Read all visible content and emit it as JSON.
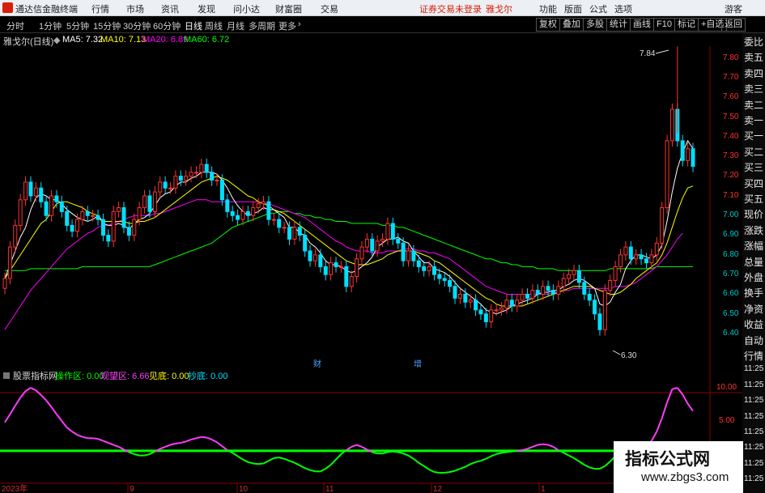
{
  "titlebar": {
    "app_name": "通达信金融终端",
    "menu": [
      "行情",
      "市场",
      "资讯",
      "发现",
      "问小达",
      "财富圈",
      "交易"
    ],
    "login_notice": "证券交易未登录",
    "stock_short": "雅戈尔",
    "right_menu": [
      "功能",
      "版面",
      "公式",
      "选项"
    ],
    "guest": "游客"
  },
  "toolbar": {
    "periods": [
      "分时",
      "1分钟",
      "5分钟",
      "15分钟",
      "30分钟",
      "60分钟",
      "日线",
      "周线",
      "月线",
      "多周期",
      "更多"
    ],
    "active_period": "日线",
    "buttons": [
      "复权",
      "叠加",
      "多股",
      "统计",
      "画线",
      "F10",
      "标记",
      "+自选",
      "返回"
    ]
  },
  "chart_header": {
    "name": "雅戈尔(日线)",
    "ma5": "MA5: 7.32",
    "ma10": "MA10: 7.13",
    "ma20": "MA20: 6.89",
    "ma60": "MA60: 6.72"
  },
  "indicator_header": {
    "name": "股票指标网",
    "op": "操作区: 0.00",
    "watch": "观望区: 6.66",
    "bottom": "见底: 0.00",
    "buy": "抄底: 0.00"
  },
  "price_axis": [
    "7.80",
    "7.70",
    "7.60",
    "7.50",
    "7.40",
    "7.30",
    "7.20",
    "7.10",
    "7.00",
    "6.90",
    "6.80",
    "6.70",
    "6.60",
    "6.50",
    "6.40"
  ],
  "ind_axis": [
    "10.00",
    "5.00"
  ],
  "annotations": {
    "high": "7.84",
    "low": "6.30"
  },
  "date_labels": [
    "2023年",
    "9",
    "10",
    "11",
    "12",
    "1"
  ],
  "event_markers": [
    "财",
    "增"
  ],
  "side_panel": [
    "委比",
    "卖五",
    "卖四",
    "卖三",
    "卖二",
    "卖一",
    "买一",
    "买二",
    "买三",
    "买四",
    "买五",
    "现价",
    "涨跌",
    "涨幅",
    "总量",
    "外盘",
    "换手",
    "净资",
    "收益",
    "自动",
    "行情",
    "11:25",
    "11:25",
    "11:25",
    "11:25",
    "11:25",
    "11:25",
    "11:25",
    "11:25"
  ],
  "watermark": {
    "title": "指标公式网",
    "url": "www.zbgs3.com"
  },
  "colors": {
    "up": "#ff3232",
    "down": "#00e0ff",
    "ma5": "#ffffff",
    "ma10": "#ffff00",
    "ma20": "#ff00ff",
    "ma60": "#00ff00",
    "ind_line": "#ff3cff",
    "ind_baseline": "#00ff00"
  },
  "chart_data": {
    "type": "candlestick",
    "title": "雅戈尔(日线)",
    "closes": [
      6.66,
      6.82,
      6.93,
      7.06,
      7.15,
      7.08,
      7.12,
      7.05,
      6.98,
      7.08,
      7.05,
      7.0,
      6.93,
      6.9,
      6.96,
      7.0,
      6.98,
      6.98,
      6.96,
      6.88,
      6.85,
      7.0,
      7.02,
      6.92,
      6.88,
      6.96,
      7.02,
      7.08,
      7.0,
      7.1,
      7.15,
      7.12,
      7.12,
      7.18,
      7.16,
      7.18,
      7.2,
      7.2,
      7.24,
      7.2,
      7.16,
      7.16,
      7.06,
      7.0,
      6.98,
      6.96,
      7.0,
      6.98,
      7.02,
      7.04,
      7.05,
      6.96,
      6.96,
      6.92,
      6.92,
      6.86,
      6.92,
      6.88,
      6.8,
      6.75,
      6.78,
      6.72,
      6.68,
      6.74,
      6.72,
      6.72,
      6.62,
      6.67,
      6.76,
      6.82,
      6.86,
      6.8,
      6.85,
      6.86,
      6.94,
      6.86,
      6.84,
      6.75,
      6.8,
      6.75,
      6.72,
      6.7,
      6.72,
      6.68,
      6.66,
      6.65,
      6.62,
      6.56,
      6.58,
      6.54,
      6.55,
      6.5,
      6.48,
      6.44,
      6.5,
      6.5,
      6.51,
      6.55,
      6.52,
      6.55,
      6.58,
      6.56,
      6.6,
      6.58,
      6.62,
      6.6,
      6.58,
      6.62,
      6.66,
      6.68,
      6.7,
      6.64,
      6.58,
      6.55,
      6.48,
      6.4,
      6.6,
      6.65,
      6.72,
      6.78,
      6.82,
      6.76,
      6.78,
      6.76,
      6.74,
      6.78,
      6.84,
      7.02,
      7.36,
      7.52,
      7.36,
      7.26,
      7.32,
      7.23
    ],
    "ma5": [
      6.66,
      6.73,
      6.8,
      6.87,
      6.92,
      7.01,
      7.07,
      7.09,
      7.08,
      7.06,
      7.06,
      7.04,
      7.01,
      6.99,
      6.97,
      6.96,
      6.95,
      6.96,
      6.98,
      6.94,
      6.93,
      6.93,
      6.94,
      6.93,
      6.91,
      6.94,
      6.96,
      6.97,
      6.99,
      7.03,
      7.07,
      7.09,
      7.1,
      7.13,
      7.15,
      7.15,
      7.17,
      7.18,
      7.2,
      7.2,
      7.2,
      7.19,
      7.16,
      7.12,
      7.07,
      7.03,
      7.0,
      6.98,
      6.99,
      7.0,
      7.02,
      7.01,
      7.01,
      6.99,
      6.97,
      6.92,
      6.92,
      6.89,
      6.88,
      6.84,
      6.82,
      6.79,
      6.75,
      6.73,
      6.73,
      6.72,
      6.7,
      6.69,
      6.7,
      6.72,
      6.74,
      6.77,
      6.82,
      6.84,
      6.86,
      6.86,
      6.87,
      6.85,
      6.84,
      6.8,
      6.77,
      6.74,
      6.74,
      6.71,
      6.7,
      6.69,
      6.67,
      6.64,
      6.61,
      6.59,
      6.57,
      6.55,
      6.53,
      6.5,
      6.49,
      6.48,
      6.49,
      6.5,
      6.52,
      6.53,
      6.54,
      6.55,
      6.56,
      6.58,
      6.59,
      6.59,
      6.6,
      6.6,
      6.62,
      6.63,
      6.65,
      6.66,
      6.65,
      6.63,
      6.61,
      6.53,
      6.52,
      6.54,
      6.59,
      6.63,
      6.71,
      6.75,
      6.78,
      6.78,
      6.77,
      6.76,
      6.78,
      6.83,
      6.95,
      7.1,
      7.22,
      7.3,
      7.36,
      7.32
    ],
    "ma10": [
      6.66,
      6.7,
      6.74,
      6.78,
      6.82,
      6.86,
      6.9,
      6.94,
      6.96,
      7.0,
      7.04,
      7.05,
      7.05,
      7.04,
      7.03,
      7.02,
      7.0,
      6.99,
      6.98,
      6.95,
      6.95,
      6.95,
      6.95,
      6.95,
      6.94,
      6.94,
      6.95,
      6.95,
      6.96,
      6.97,
      6.99,
      7.01,
      7.03,
      7.05,
      7.07,
      7.09,
      7.11,
      7.13,
      7.15,
      7.16,
      7.17,
      7.18,
      7.17,
      7.16,
      7.14,
      7.12,
      7.1,
      7.08,
      7.07,
      7.05,
      7.04,
      7.03,
      7.01,
      7.0,
      6.99,
      6.97,
      6.95,
      6.93,
      6.91,
      6.89,
      6.87,
      6.85,
      6.83,
      6.81,
      6.79,
      6.77,
      6.75,
      6.74,
      6.73,
      6.73,
      6.73,
      6.74,
      6.75,
      6.76,
      6.78,
      6.79,
      6.8,
      6.8,
      6.8,
      6.8,
      6.79,
      6.78,
      6.77,
      6.75,
      6.74,
      6.72,
      6.7,
      6.68,
      6.66,
      6.64,
      6.62,
      6.6,
      6.58,
      6.56,
      6.55,
      6.53,
      6.52,
      6.52,
      6.52,
      6.52,
      6.52,
      6.53,
      6.54,
      6.55,
      6.56,
      6.57,
      6.58,
      6.59,
      6.6,
      6.61,
      6.62,
      6.62,
      6.62,
      6.62,
      6.61,
      6.6,
      6.59,
      6.58,
      6.58,
      6.59,
      6.61,
      6.63,
      6.66,
      6.68,
      6.7,
      6.72,
      6.74,
      6.78,
      6.84,
      6.92,
      7.0,
      7.07,
      7.12,
      7.13
    ],
    "ma20": [
      6.4,
      6.44,
      6.48,
      6.52,
      6.56,
      6.6,
      6.63,
      6.66,
      6.69,
      6.72,
      6.75,
      6.78,
      6.81,
      6.83,
      6.85,
      6.87,
      6.89,
      6.9,
      6.92,
      6.93,
      6.93,
      6.94,
      6.95,
      6.96,
      6.97,
      6.98,
      6.98,
      6.98,
      6.98,
      6.99,
      6.99,
      7.0,
      7.01,
      7.02,
      7.03,
      7.04,
      7.05,
      7.06,
      7.06,
      7.06,
      7.05,
      7.05,
      7.05,
      7.05,
      7.05,
      7.05,
      7.05,
      7.05,
      7.05,
      7.05,
      7.04,
      7.04,
      7.03,
      7.02,
      7.01,
      7.0,
      6.99,
      6.98,
      6.97,
      6.95,
      6.93,
      6.91,
      6.89,
      6.87,
      6.85,
      6.84,
      6.82,
      6.81,
      6.8,
      6.8,
      6.8,
      6.79,
      6.79,
      6.79,
      6.8,
      6.8,
      6.8,
      6.81,
      6.81,
      6.81,
      6.8,
      6.8,
      6.79,
      6.79,
      6.78,
      6.77,
      6.76,
      6.74,
      6.72,
      6.7,
      6.68,
      6.66,
      6.64,
      6.62,
      6.61,
      6.6,
      6.59,
      6.58,
      6.58,
      6.58,
      6.58,
      6.58,
      6.58,
      6.58,
      6.58,
      6.58,
      6.59,
      6.59,
      6.6,
      6.6,
      6.61,
      6.61,
      6.61,
      6.61,
      6.61,
      6.61,
      6.61,
      6.61,
      6.62,
      6.62,
      6.62,
      6.63,
      6.64,
      6.66,
      6.68,
      6.7,
      6.72,
      6.75,
      6.78,
      6.82,
      6.86,
      6.89
    ],
    "ma60": [
      6.7,
      6.7,
      6.7,
      6.7,
      6.7,
      6.71,
      6.71,
      6.71,
      6.71,
      6.71,
      6.71,
      6.71,
      6.71,
      6.71,
      6.71,
      6.72,
      6.72,
      6.72,
      6.72,
      6.72,
      6.72,
      6.72,
      6.72,
      6.72,
      6.72,
      6.72,
      6.72,
      6.72,
      6.72,
      6.73,
      6.74,
      6.75,
      6.76,
      6.77,
      6.78,
      6.79,
      6.8,
      6.81,
      6.82,
      6.83,
      6.84,
      6.86,
      6.88,
      6.9,
      6.92,
      6.93,
      6.94,
      6.95,
      6.96,
      6.97,
      6.98,
      6.99,
      6.99,
      7.0,
      7.0,
      7.0,
      6.99,
      6.99,
      6.98,
      6.98,
      6.97,
      6.97,
      6.96,
      6.96,
      6.95,
      6.95,
      6.95,
      6.94,
      6.94,
      6.94,
      6.94,
      6.94,
      6.94,
      6.93,
      6.93,
      6.93,
      6.92,
      6.92,
      6.91,
      6.9,
      6.89,
      6.88,
      6.87,
      6.86,
      6.85,
      6.84,
      6.83,
      6.82,
      6.81,
      6.8,
      6.79,
      6.78,
      6.77,
      6.76,
      6.76,
      6.75,
      6.74,
      6.74,
      6.73,
      6.73,
      6.72,
      6.72,
      6.72,
      6.71,
      6.71,
      6.71,
      6.71,
      6.7,
      6.7,
      6.7,
      6.7,
      6.7,
      6.7,
      6.7,
      6.7,
      6.7,
      6.7,
      6.71,
      6.71,
      6.71,
      6.71,
      6.71,
      6.71,
      6.71,
      6.71,
      6.71,
      6.72,
      6.72,
      6.72,
      6.72,
      6.72,
      6.72,
      6.72,
      6.72
    ],
    "indicator": [
      4.8,
      6.0,
      7.3,
      8.5,
      9.5,
      10.0,
      9.6,
      8.9,
      8.1,
      7.1,
      6.0,
      5.0,
      4.0,
      3.4,
      2.9,
      2.6,
      2.4,
      2.4,
      2.3,
      2.0,
      1.7,
      1.4,
      1.1,
      0.7,
      0.3,
      0.0,
      -0.2,
      -0.2,
      0.0,
      0.4,
      0.8,
      1.1,
      1.4,
      1.6,
      1.7,
      1.9,
      2.2,
      2.4,
      2.6,
      2.5,
      2.2,
      1.8,
      1.2,
      0.6,
      0.2,
      -0.3,
      -0.8,
      -1.2,
      -1.4,
      -1.5,
      -1.4,
      -1.0,
      -0.6,
      -0.5,
      -0.7,
      -1.0,
      -1.3,
      -1.7,
      -2.1,
      -2.4,
      -2.6,
      -2.6,
      -2.2,
      -1.6,
      -0.8,
      0.0,
      0.6,
      1.1,
      1.4,
      1.1,
      0.7,
      0.3,
      0.1,
      0.1,
      0.3,
      0.4,
      0.3,
      0.1,
      -0.2,
      -0.7,
      -1.3,
      -1.8,
      -2.3,
      -2.7,
      -2.8,
      -2.8,
      -2.7,
      -2.5,
      -2.2,
      -1.9,
      -1.5,
      -1.2,
      -1.0,
      -0.7,
      -0.3,
      0.0,
      0.2,
      0.3,
      0.4,
      0.5,
      0.6,
      0.8,
      1.1,
      1.4,
      1.5,
      1.4,
      1.1,
      0.6,
      0.2,
      -0.2,
      -0.6,
      -1.1,
      -1.6,
      -2.0,
      -2.2,
      -2.2,
      -1.8,
      -1.1,
      -0.3,
      0.3,
      0.6,
      0.8,
      0.7,
      0.8,
      1.2,
      2.0,
      3.4,
      5.4,
      7.8,
      9.8,
      10.0,
      9.0,
      7.6,
      6.5
    ],
    "indicator_baseline": 0.5
  }
}
